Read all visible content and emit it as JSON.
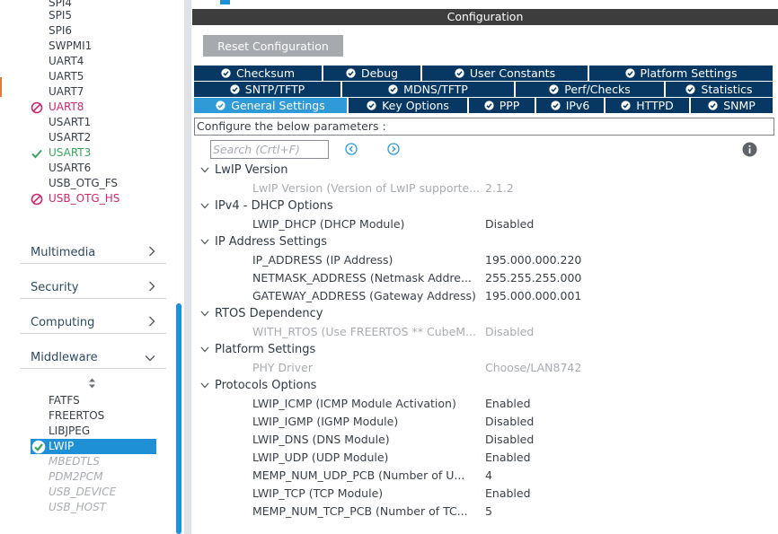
{
  "peripherals": [
    {
      "label": "SPI4",
      "state": "normal"
    },
    {
      "label": "SPI5",
      "state": "normal"
    },
    {
      "label": "SPI6",
      "state": "normal"
    },
    {
      "label": "SWPMI1",
      "state": "normal"
    },
    {
      "label": "UART4",
      "state": "normal"
    },
    {
      "label": "UART5",
      "state": "normal"
    },
    {
      "label": "UART7",
      "state": "normal"
    },
    {
      "label": "UART8",
      "state": "error"
    },
    {
      "label": "USART1",
      "state": "normal"
    },
    {
      "label": "USART2",
      "state": "normal"
    },
    {
      "label": "USART3",
      "state": "ok"
    },
    {
      "label": "USART6",
      "state": "normal"
    },
    {
      "label": "USB_OTG_FS",
      "state": "normal"
    },
    {
      "label": "USB_OTG_HS",
      "state": "error"
    }
  ],
  "categories": [
    {
      "label": "Multimedia",
      "chevron": "right"
    },
    {
      "label": "Security",
      "chevron": "right"
    },
    {
      "label": "Computing",
      "chevron": "right"
    },
    {
      "label": "Middleware",
      "chevron": "down"
    }
  ],
  "middleware": [
    {
      "label": "FATFS",
      "state": "normal"
    },
    {
      "label": "FREERTOS",
      "state": "normal"
    },
    {
      "label": "LIBJPEG",
      "state": "normal"
    },
    {
      "label": "LWIP",
      "state": "selected"
    },
    {
      "label": "MBEDTLS",
      "state": "disabled"
    },
    {
      "label": "PDM2PCM",
      "state": "disabled"
    },
    {
      "label": "USB_DEVICE",
      "state": "disabled"
    },
    {
      "label": "USB_HOST",
      "state": "disabled"
    }
  ],
  "header": {
    "title": "Configuration",
    "reset_label": "Reset Configuration"
  },
  "tabs": {
    "row1": [
      "Checksum",
      "Debug",
      "User Constants",
      "Platform Settings"
    ],
    "row2": [
      "SNTP/TFTP",
      "MDNS/TFTP",
      "Perf/Checks",
      "Statistics"
    ],
    "row3": [
      "General Settings",
      "Key Options",
      "PPP",
      "IPv6",
      "HTTPD",
      "SNMP"
    ],
    "active": "General Settings"
  },
  "description": "Configure the below parameters :",
  "search": {
    "placeholder": "Search (Crtl+F)"
  },
  "groups": [
    {
      "title": "LwIP Version",
      "params": [
        {
          "name": "LwIP Version (Version of LwIP supporte...",
          "value": "2.1.2",
          "disabled": true
        }
      ]
    },
    {
      "title": "IPv4 - DHCP Options",
      "params": [
        {
          "name": "LWIP_DHCP (DHCP Module)",
          "value": "Disabled",
          "disabled": false
        }
      ]
    },
    {
      "title": "IP Address Settings",
      "params": [
        {
          "name": "IP_ADDRESS (IP Address)",
          "value": "195.000.000.220",
          "disabled": false
        },
        {
          "name": "NETMASK_ADDRESS (Netmask Addre...",
          "value": "255.255.255.000",
          "disabled": false
        },
        {
          "name": "GATEWAY_ADDRESS (Gateway Address)",
          "value": "195.000.000.001",
          "disabled": false
        }
      ]
    },
    {
      "title": "RTOS Dependency",
      "params": [
        {
          "name": "WITH_RTOS (Use FREERTOS ** CubeM...",
          "value": "Disabled",
          "disabled": true
        }
      ]
    },
    {
      "title": "Platform Settings",
      "params": [
        {
          "name": "PHY Driver",
          "value": "Choose/LAN8742",
          "disabled": true
        }
      ]
    },
    {
      "title": "Protocols Options",
      "params": [
        {
          "name": "LWIP_ICMP (ICMP Module Activation)",
          "value": "Enabled",
          "disabled": false
        },
        {
          "name": "LWIP_IGMP (IGMP Module)",
          "value": "Disabled",
          "disabled": false
        },
        {
          "name": "LWIP_DNS (DNS Module)",
          "value": "Disabled",
          "disabled": false
        },
        {
          "name": "LWIP_UDP (UDP Module)",
          "value": "Enabled",
          "disabled": false
        },
        {
          "name": "MEMP_NUM_UDP_PCB (Number of U...",
          "value": "4",
          "disabled": false
        },
        {
          "name": "LWIP_TCP (TCP Module)",
          "value": "Enabled",
          "disabled": false
        },
        {
          "name": "MEMP_NUM_TCP_PCB (Number of TC...",
          "value": "5",
          "disabled": false
        }
      ]
    }
  ],
  "colors": {
    "accent": "#1e90d6",
    "tab_dark": "#073763",
    "tab_active": "#2f9ad8",
    "error": "#d0246f",
    "ok": "#3aa55e",
    "header": "#3d3d3d"
  }
}
